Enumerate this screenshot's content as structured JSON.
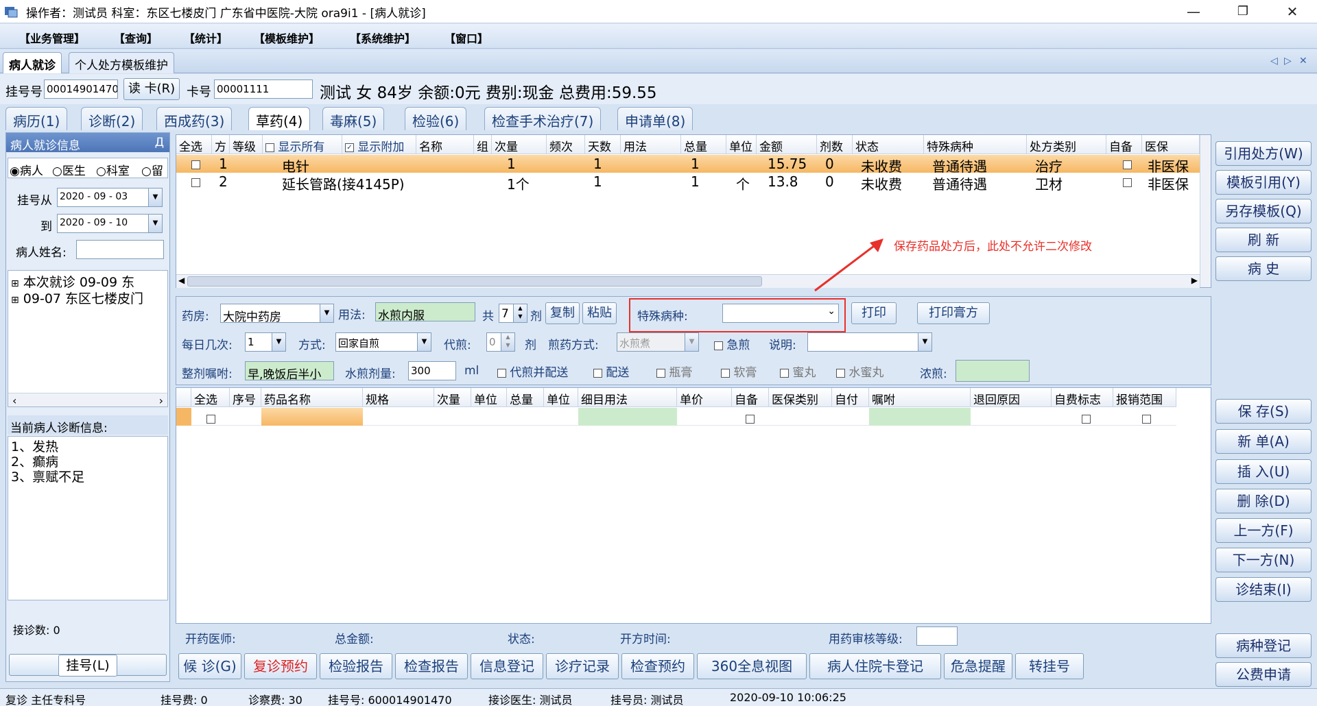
{
  "window": {
    "title": "操作者：测试员   科室：东区七楼皮门   广东省中医院-大院 ora9i1 - [病人就诊]",
    "minimize": "—",
    "restore": "❐",
    "close": "✕"
  },
  "menu": [
    "【业务管理】",
    "【查询】",
    "【统计】",
    "【模板维护】",
    "【系统维护】",
    "【窗口】"
  ],
  "top_tabs": [
    "病人就诊",
    "个人处方模板维护"
  ],
  "tab_controls": [
    "◁",
    "▷",
    "✕"
  ],
  "patient": {
    "reg_label": "挂号号",
    "reg_no": "00014901470",
    "read_card": "读 卡(R)",
    "card_label": "卡号",
    "card_no": "00001111",
    "summary": "测试 女 84岁 余额:0元 费别:现金 总费用:59.55"
  },
  "sub_tabs": [
    "病历(1)",
    "诊断(2)",
    "西成药(3)",
    "草药(4)",
    "毒麻(5)",
    "检验(6)",
    "检查手术治疗(7)",
    "申请单(8)"
  ],
  "left": {
    "title": "病人就诊信息",
    "pin": "Д",
    "radios": [
      "病人",
      "医生",
      "科室",
      "留"
    ],
    "date_from_label": "挂号从",
    "date_from": "2020 - 09 - 03",
    "date_to_label": "到",
    "date_to": "2020 - 09 - 10",
    "name_label": "病人姓名:",
    "tree": [
      "本次就诊 09-09 东",
      "09-07 东区七楼皮门"
    ],
    "diag_title": "当前病人诊断信息:",
    "diagnoses": [
      "1、发热",
      "2、癫病",
      "3、禀赋不足"
    ],
    "count_label": "接诊数: 0",
    "register_btn": "挂号(L)"
  },
  "grid1": {
    "headers": [
      "全选",
      "方",
      "等级",
      "显示所有",
      "显示附加",
      "名称",
      "组",
      "次量",
      "频次",
      "天数",
      "用法",
      "总量",
      "单位",
      "金额",
      "剂数",
      "状态",
      "特殊病种",
      "处方类别",
      "自备",
      "医保"
    ],
    "rows": [
      {
        "no": "1",
        "name": "电针",
        "dose": "1",
        "days": "1",
        "total": "1",
        "unit": "",
        "amount": "15.75",
        "qty": "0",
        "status": "未收费",
        "special": "普通待遇",
        "category": "治疗",
        "insurance": "非医保"
      },
      {
        "no": "2",
        "name": "延长管路(接4145P)",
        "dose": "1个",
        "days": "1",
        "total": "1",
        "unit": "个",
        "amount": "13.8",
        "qty": "0",
        "status": "未收费",
        "special": "普通待遇",
        "category": "卫材",
        "insurance": "非医保"
      }
    ],
    "annotation": "保存药品处方后，此处不允许二次修改",
    "annotation_color": "#e8302a"
  },
  "form": {
    "pharmacy_label": "药房:",
    "pharmacy": "大院中药房",
    "usage_label": "用法:",
    "usage": "水煎内服",
    "total_label": "共",
    "total_doses": "7",
    "dose_unit": "剂",
    "copy": "复制",
    "paste": "粘贴",
    "special_label": "特殊病种:",
    "special_value": "",
    "print": "打印",
    "print_paste": "打印膏方",
    "times_label": "每日几次:",
    "times": "1",
    "method_label": "方式:",
    "method": "回家自煎",
    "decoct_label": "代煎:",
    "decoct": "0",
    "decoct_unit": "剂",
    "decoct_way_label": "煎药方式:",
    "decoct_way": "水煎煮",
    "urgent": "急煎",
    "note_label": "说明:",
    "instruction_label": "整剂嘱咐:",
    "instruction": "早,晚饭后半小",
    "water_label": "水煎剂量:",
    "water": "300",
    "water_unit": "ml",
    "opt1": "代煎并配送",
    "opt2": "配送",
    "opt3": "瓶膏",
    "opt4": "软膏",
    "opt5": "蜜丸",
    "opt6": "水蜜丸",
    "concentrate_label": "浓煎:"
  },
  "grid2": {
    "headers": [
      "全选",
      "序号",
      "药品名称",
      "规格",
      "次量",
      "单位",
      "总量",
      "单位",
      "细目用法",
      "单价",
      "自备",
      "医保类别",
      "自付",
      "嘱咐",
      "退回原因",
      "自费标志",
      "报销范围"
    ]
  },
  "summary_bar": {
    "doctor": "开药医师:",
    "total": "总金额:",
    "state": "状态:",
    "time": "开方时间:",
    "review": "用药审核等级:"
  },
  "actions": [
    "候 诊(G)",
    "复诊预约",
    "检验报告",
    "检查报告",
    "信息登记",
    "诊疗记录",
    "检查预约",
    "360全息视图",
    "病人住院卡登记",
    "危急提醒",
    "转挂号"
  ],
  "right_buttons_top": [
    "引用处方(W)",
    "模板引用(Y)",
    "另存模板(Q)",
    "刷 新",
    "病 史"
  ],
  "right_buttons_mid": [
    "保 存(S)",
    "新 单(A)",
    "插 入(U)",
    "删 除(D)",
    "上一方(F)",
    "下一方(N)",
    "诊结束(I)"
  ],
  "right_buttons_bottom": [
    "病种登记",
    "公费申请"
  ],
  "status": {
    "type": "复诊 主任专科号",
    "reg_fee": "挂号费:   0",
    "exam_fee": "诊察费: 30",
    "reg_no": "挂号号:   600014901470",
    "doctor": "接诊医生:   测试员",
    "registrar": "挂号员: 测试员",
    "datetime": "2020-09-10 10:06:25"
  }
}
